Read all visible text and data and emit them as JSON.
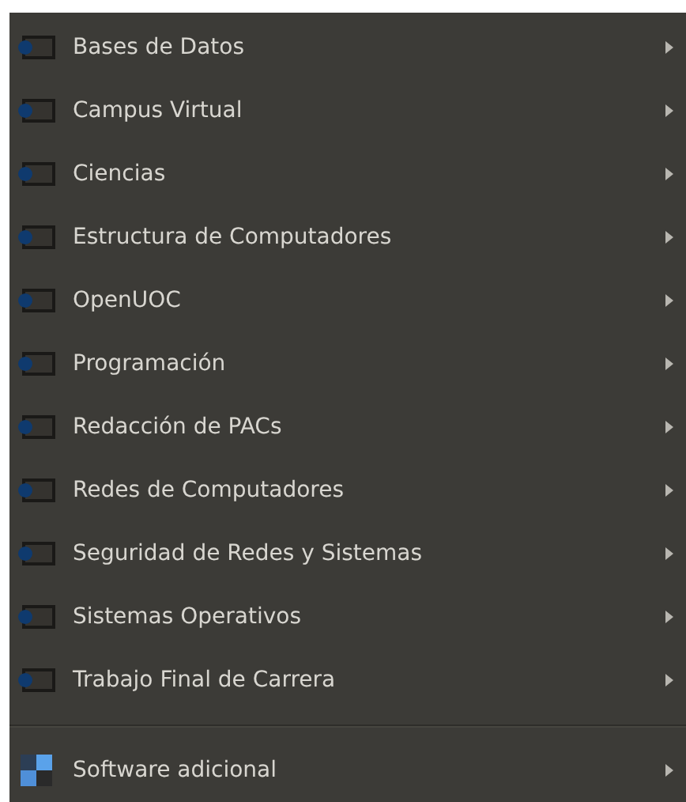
{
  "menu": {
    "groups": [
      {
        "items": [
          {
            "label": "Bases de Datos",
            "kind": "course"
          },
          {
            "label": "Campus Virtual",
            "kind": "course"
          },
          {
            "label": "Ciencias",
            "kind": "course"
          },
          {
            "label": "Estructura de Computadores",
            "kind": "course"
          },
          {
            "label": "OpenUOC",
            "kind": "course"
          },
          {
            "label": "Programación",
            "kind": "course"
          },
          {
            "label": "Redacción de PACs",
            "kind": "course"
          },
          {
            "label": "Redes de Computadores",
            "kind": "course"
          },
          {
            "label": "Seguridad de Redes y Sistemas",
            "kind": "course"
          },
          {
            "label": "Sistemas Operativos",
            "kind": "course"
          },
          {
            "label": "Trabajo Final de Carrera",
            "kind": "course"
          }
        ]
      },
      {
        "items": [
          {
            "label": "Software adicional",
            "kind": "software"
          }
        ]
      }
    ]
  }
}
